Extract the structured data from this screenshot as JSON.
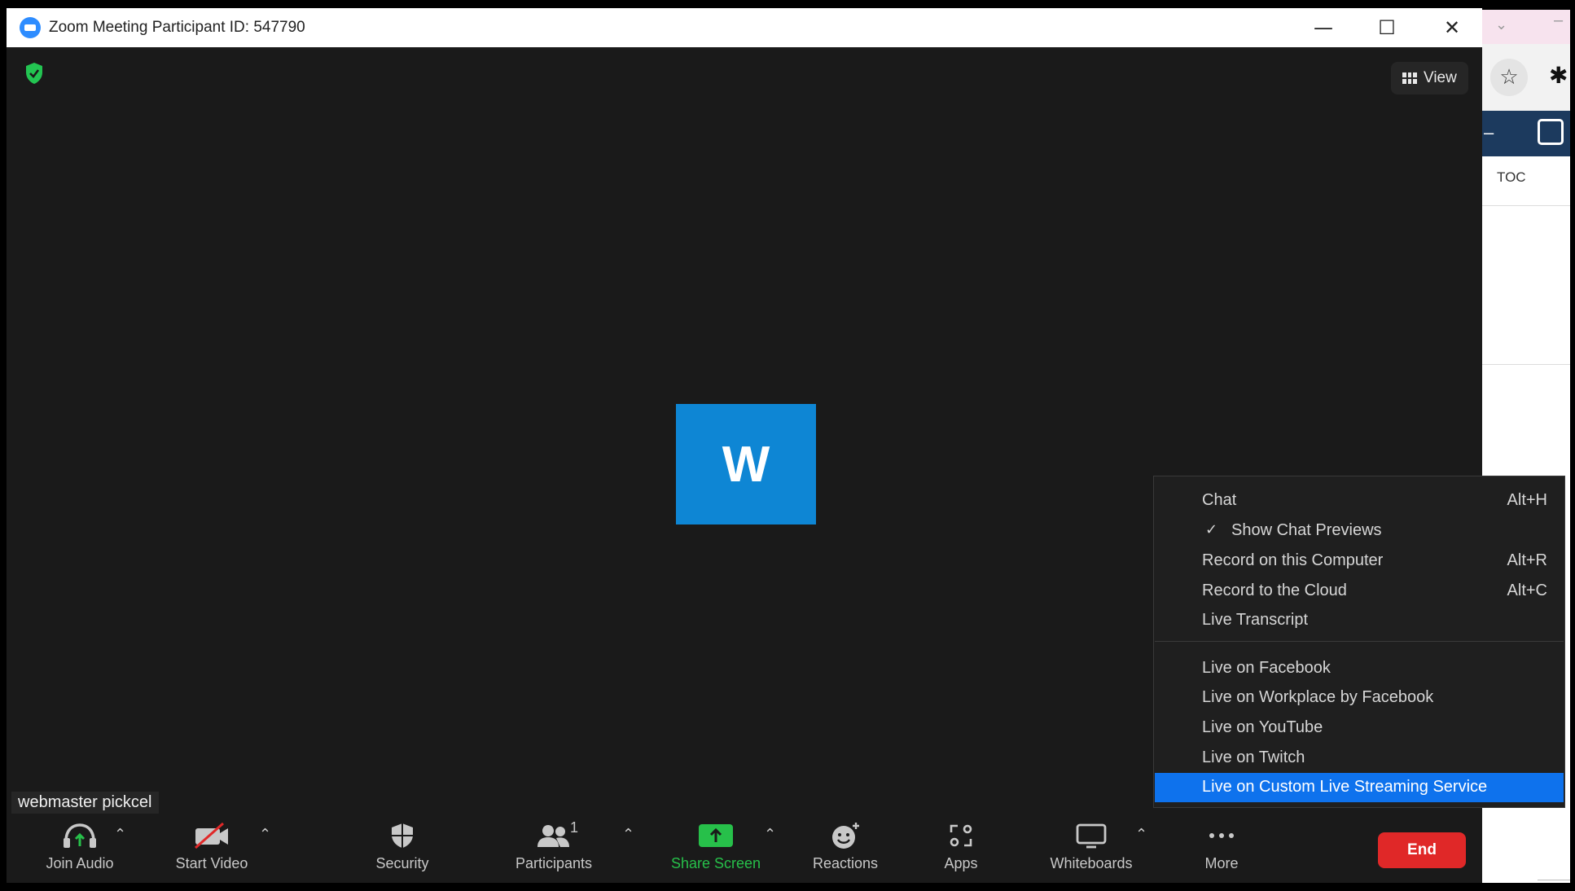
{
  "browser": {
    "toc_label": "TOC"
  },
  "window": {
    "title": "Zoom Meeting Participant ID: 547790",
    "minimize": "—",
    "maximize": "☐",
    "close": "✕"
  },
  "view_button": {
    "label": "View"
  },
  "avatar": {
    "initial": "W",
    "color": "#0e86d4"
  },
  "participant_name": "webmaster pickcel",
  "toolbar": {
    "join_audio": "Join Audio",
    "start_video": "Start Video",
    "security": "Security",
    "participants": "Participants",
    "participants_count": "1",
    "share_screen": "Share Screen",
    "reactions": "Reactions",
    "apps": "Apps",
    "whiteboards": "Whiteboards",
    "more": "More",
    "end": "End",
    "caret": "⌃"
  },
  "more_menu": {
    "items": [
      {
        "label": "Chat",
        "shortcut": "Alt+H"
      },
      {
        "label": "Show Chat Previews",
        "checked": true,
        "check": "✓"
      },
      {
        "label": "Record on this Computer",
        "shortcut": "Alt+R"
      },
      {
        "label": "Record to the Cloud",
        "shortcut": "Alt+C"
      },
      {
        "label": "Live Transcript"
      },
      {
        "label": "Live on Facebook"
      },
      {
        "label": "Live on Workplace by Facebook"
      },
      {
        "label": "Live on YouTube"
      },
      {
        "label": "Live on Twitch"
      },
      {
        "label": "Live on Custom Live Streaming Service",
        "highlighted": true
      }
    ]
  },
  "colors": {
    "share_green": "#27c04a",
    "end_red": "#e02828",
    "highlight_blue": "#0e72ed",
    "meeting_bg": "#1a1a1a"
  }
}
